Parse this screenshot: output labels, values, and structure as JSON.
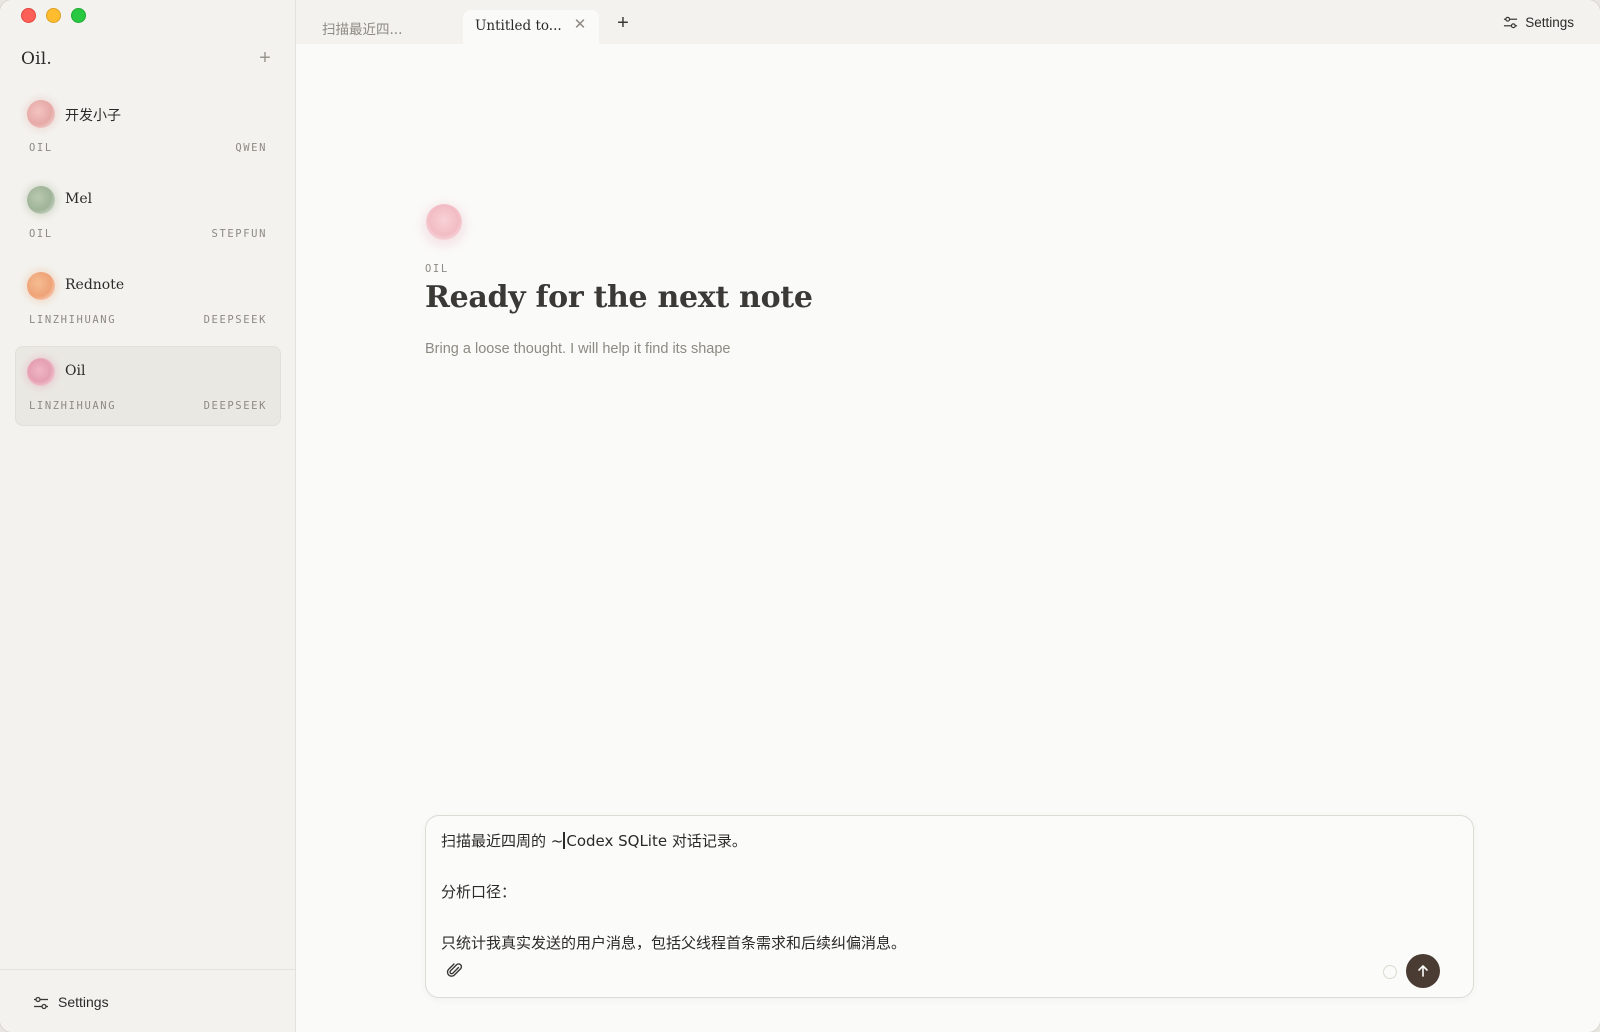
{
  "window": {
    "controls": [
      "close",
      "minimize",
      "zoom"
    ]
  },
  "sidebar": {
    "brand": "Oil.",
    "add_icon": "plus-icon",
    "agents": [
      {
        "name": "开发小子",
        "owner": "OIL",
        "model": "QWEN",
        "avatar_color": "#e6a9a6",
        "active": false
      },
      {
        "name": "Mel",
        "owner": "OIL",
        "model": "STEPFUN",
        "avatar_color": "#9fb499",
        "active": false
      },
      {
        "name": "Rednote",
        "owner": "LINZHIHUANG",
        "model": "DEEPSEEK",
        "avatar_color": "#efa277",
        "active": false
      },
      {
        "name": "Oil",
        "owner": "LINZHIHUANG",
        "model": "DEEPSEEK",
        "avatar_color": "#e5a0b3",
        "active": true
      }
    ],
    "footer": {
      "settings_label": "Settings",
      "icon": "sliders-icon"
    }
  },
  "tabs": [
    {
      "label": "扫描最近四...",
      "active": false
    },
    {
      "label": "Untitled to...",
      "active": true,
      "close_icon": "close-icon"
    }
  ],
  "new_tab_icon": "plus-icon",
  "top_settings": {
    "label": "Settings",
    "icon": "sliders-icon"
  },
  "hero": {
    "owner": "OIL",
    "title": "Ready for the next note",
    "subtitle": "Bring a loose thought. I will help it find its shape"
  },
  "composer": {
    "line1_before_cursor": "扫描最近四周的 ~",
    "line1_after_cursor": "Codex SQLite 对话记录。",
    "line2": "分析口径：",
    "line3": "只统计我真实发送的用户消息，包括父线程首条需求和后续纠偏消息。",
    "attach_icon": "paperclip-icon",
    "send_icon": "arrow-up-icon"
  },
  "colors": {
    "send_button": "#4a3b33",
    "sidebar_bg": "#f3f2ee",
    "main_bg": "#fafaf8"
  }
}
